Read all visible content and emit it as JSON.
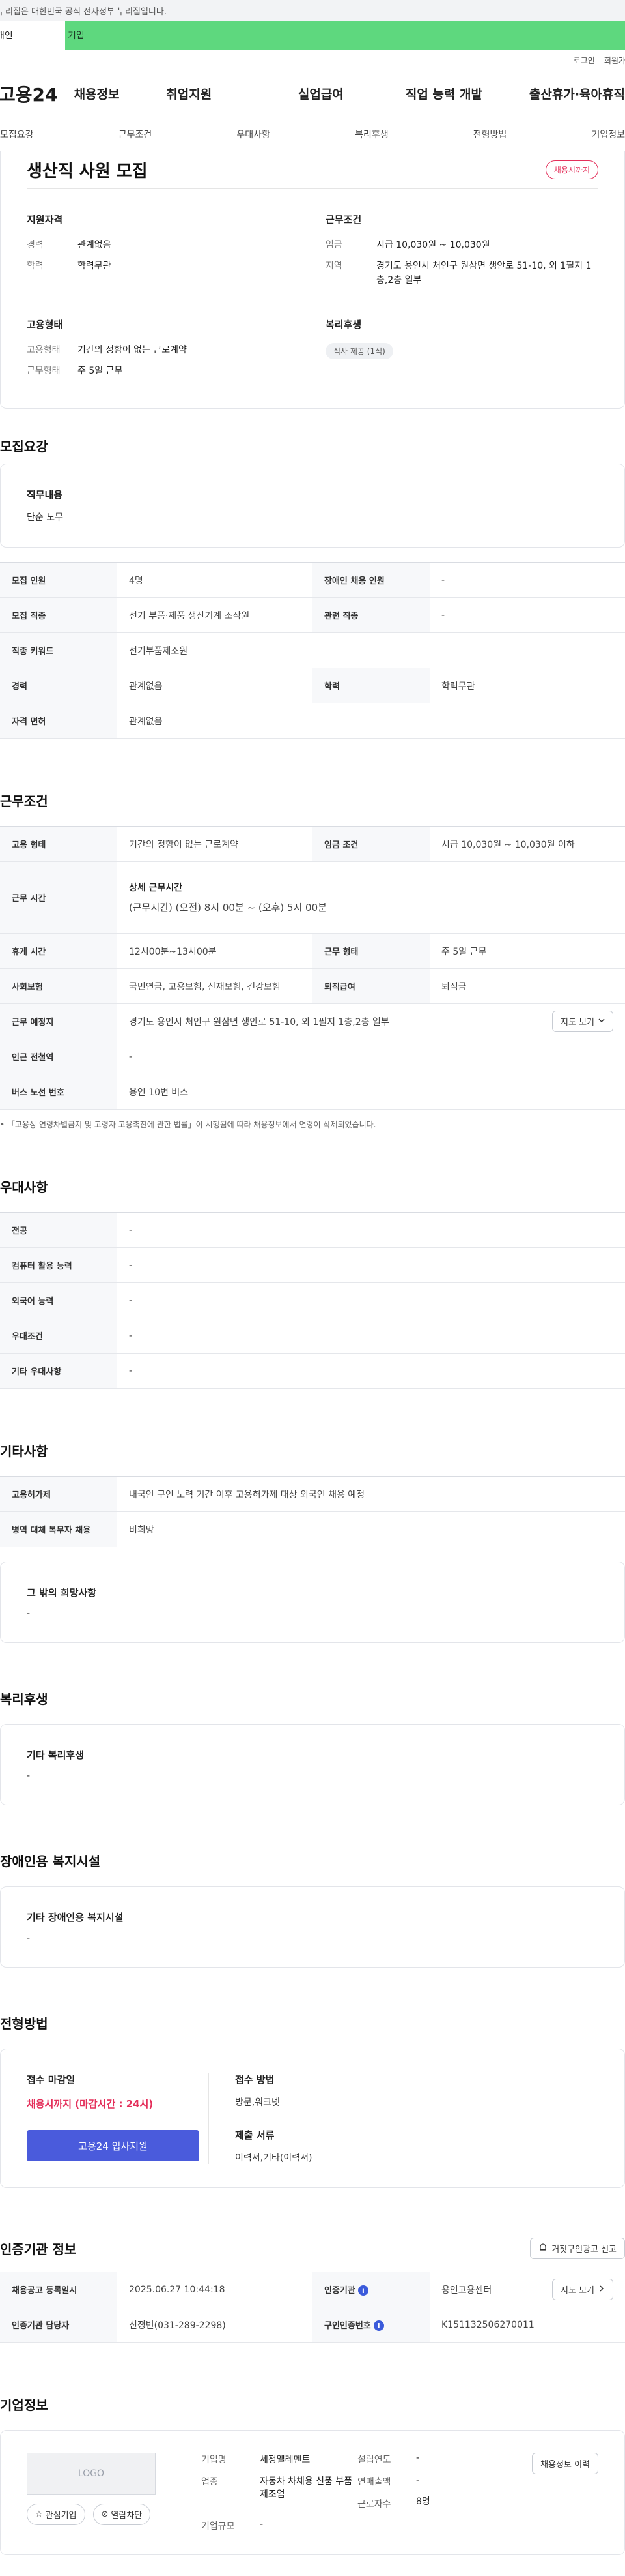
{
  "notice": "이 누리집은 대한민국 공식 전자정부 누리집입니다.",
  "gov_tabs": [
    "개인",
    "기업"
  ],
  "util_links": [
    "로그인",
    "회원가입"
  ],
  "logo": "고용24",
  "gnb": [
    "채용정보",
    "취업지원",
    "실업급여",
    "직업 능력 개발",
    "출산휴가·육아휴직"
  ],
  "lnb": [
    "모집요강",
    "근무조건",
    "우대사항",
    "복리후생",
    "전형방법",
    "기업정보"
  ],
  "job": {
    "title": "생산직 사원 모집",
    "deadline_badge": "채용시까지"
  },
  "summary": {
    "qual": {
      "heading": "지원자격",
      "rows": [
        {
          "k": "경력",
          "v": "관계없음"
        },
        {
          "k": "학력",
          "v": "학력무관"
        }
      ]
    },
    "cond": {
      "heading": "근무조건",
      "rows": [
        {
          "k": "임금",
          "v": "시급 10,030원 ~ 10,030원"
        },
        {
          "k": "지역",
          "v": "경기도 용인시 처인구 원삼면 생안로 51-10, 외 1필지 1층,2층 일부"
        }
      ]
    },
    "employ": {
      "heading": "고용형태",
      "rows": [
        {
          "k": "고용형태",
          "v": "기간의 정함이 없는 근로계약"
        },
        {
          "k": "근무형태",
          "v": "주 5일 근무"
        }
      ]
    },
    "welfare": {
      "heading": "복리후생",
      "chip": "식사 제공 (1식)"
    }
  },
  "recruit": {
    "title": "모집요강",
    "duty_label": "직무내용",
    "duty_value": "단순 노무",
    "rows": [
      {
        "k1": "모집 인원",
        "v1": "4명",
        "k2": "장애인 채용 인원",
        "v2": "-"
      },
      {
        "k1": "모집 직종",
        "v1": "전기 부품·제품 생산기계 조작원",
        "k2": "관련 직종",
        "v2": "-"
      },
      {
        "k1": "직종 키워드",
        "v1": "전기부품제조원"
      },
      {
        "k1": "경력",
        "v1": "관계없음",
        "k2": "학력",
        "v2": "학력무관"
      },
      {
        "k1": "자격 면허",
        "v1": "관계없음"
      }
    ]
  },
  "work": {
    "title": "근무조건",
    "employ_type_k": "고용 형태",
    "employ_type_v": "기간의 정함이 없는 근로계약",
    "wage_k": "임금 조건",
    "wage_v": "시급 10,030원 ~ 10,030원 이하",
    "hours_k": "근무 시간",
    "hours_sub": "상세 근무시간",
    "hours_v": "(근무시간) (오전) 8시 00분 ~ (오후) 5시 00분",
    "break_k": "휴게 시간",
    "break_v": "12시00분~13시00분",
    "shift_k": "근무 형태",
    "shift_v": "주 5일 근무",
    "insurance_k": "사회보험",
    "insurance_v": "국민연금, 고용보험, 산재보험, 건강보험",
    "severance_k": "퇴직급여",
    "severance_v": "퇴직금",
    "place_k": "근무 예정지",
    "place_v": "경기도 용인시 처인구 원삼면 생안로 51-10, 외 1필지 1층,2층 일부",
    "map_btn": "지도 보기",
    "station_k": "인근 전철역",
    "station_v": "-",
    "bus_k": "버스 노선 번호",
    "bus_v": "용인 10번 버스",
    "footnote": "「고용상 연령차별금지 및 고령자 고용촉진에 관한 법률」이 시행됨에 따라 채용정보에서 연령이 삭제되었습니다."
  },
  "pref": {
    "title": "우대사항",
    "rows": [
      {
        "k": "전공",
        "v": "-"
      },
      {
        "k": "컴퓨터 활용 능력",
        "v": "-"
      },
      {
        "k": "외국어 능력",
        "v": "-"
      },
      {
        "k": "우대조건",
        "v": "-"
      },
      {
        "k": "기타 우대사항",
        "v": "-"
      }
    ]
  },
  "etc": {
    "title": "기타사항",
    "rows": [
      {
        "k": "고용허가제",
        "v": "내국인 구인 노력 기간 이후 고용허가제 대상 외국인 채용 예정"
      },
      {
        "k": "병역 대체 복무자 채용",
        "v": "비희망"
      }
    ],
    "other_label": "그 밖의 희망사항",
    "other_value": "-"
  },
  "welfare": {
    "title": "복리후생",
    "label": "기타 복리후생",
    "value": "-"
  },
  "disability": {
    "title": "장애인용 복지시설",
    "label": "기타 장애인용 복지시설",
    "value": "-"
  },
  "apply": {
    "title": "전형방법",
    "deadline_label": "접수 마감일",
    "deadline_value": "채용시까지 (마감시간 : 24시)",
    "apply_btn": "고용24 입사지원",
    "method_label": "접수 방법",
    "method_value": "방문,워크넷",
    "docs_label": "제출 서류",
    "docs_value": "이력서,기타(이력서)"
  },
  "cert": {
    "title": "인증기관 정보",
    "report_btn": "거짓구인광고 신고",
    "reg_k": "채용공고 등록일시",
    "reg_v": "2025.06.27 10:44:18",
    "org_k": "인증기관",
    "org_v": "용인고용센터",
    "map_btn": "지도 보기",
    "mgr_k": "인증기관 담당자",
    "mgr_v": "신정빈(031-289-2298)",
    "num_k": "구인인증번호",
    "num_v": "K151132506270011"
  },
  "company": {
    "title": "기업정보",
    "logo_text": "LOGO",
    "fav_btn": "관심기업",
    "block_btn": "열람차단",
    "history_btn": "채용정보 이력",
    "name_k": "기업명",
    "name_v": "세정엘레멘트",
    "ind_k": "업종",
    "ind_v": "자동차 차체용 신품 부품 제조업",
    "size_k": "기업규모",
    "size_v": "-",
    "year_k": "설립연도",
    "year_v": "-",
    "sales_k": "연매출액",
    "sales_v": "-",
    "emp_k": "근로자수",
    "emp_v": "8명"
  }
}
